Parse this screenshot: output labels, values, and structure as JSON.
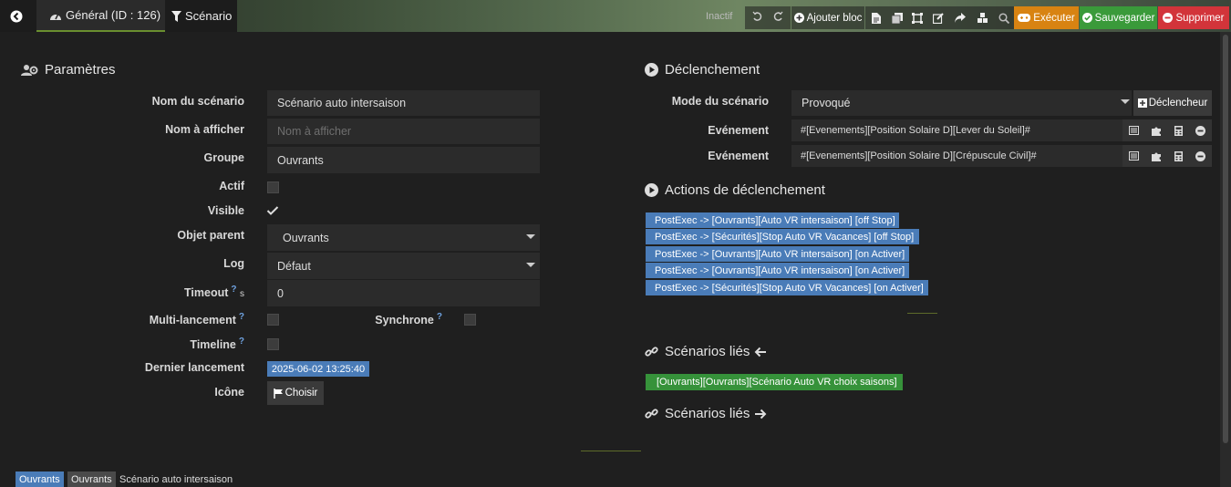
{
  "topbar": {
    "tab_general": "Général (ID : 126)",
    "tab_scenario": "Scénario",
    "status": "Inactif",
    "add_block": "Ajouter bloc",
    "execute": "Exécuter",
    "save": "Sauvegarder",
    "delete": "Supprimer",
    "colors": {
      "execute": "#d88312",
      "save": "#3a9a3a",
      "delete": "#d2343a"
    }
  },
  "params": {
    "title": "Paramètres",
    "name_label": "Nom du scénario",
    "name_value": "Scénario auto intersaison",
    "display_label": "Nom à afficher",
    "display_placeholder": "Nom à afficher",
    "group_label": "Groupe",
    "group_value": "Ouvrants",
    "active_label": "Actif",
    "active": false,
    "visible_label": "Visible",
    "visible": true,
    "parent_label": "Objet parent",
    "parent_value": "Ouvrants",
    "log_label": "Log",
    "log_value": "Défaut",
    "timeout_label": "Timeout",
    "timeout_unit": "s",
    "timeout_value": "0",
    "multi_label": "Multi-lancement",
    "multi": false,
    "sync_label": "Synchrone",
    "sync": false,
    "timeline_label": "Timeline",
    "timeline": false,
    "last_run_label": "Dernier lancement",
    "last_run_value": "2025-06-02 13:25:40",
    "icon_label": "Icône",
    "choose_button": "Choisir"
  },
  "trigger": {
    "title": "Déclenchement",
    "mode_label": "Mode du scénario",
    "mode_value": "Provoqué",
    "trigger_button": "Déclencheur",
    "events": [
      {
        "label": "Evénement",
        "value": "#[Evenements][Position Solaire D][Lever du Soleil]#"
      },
      {
        "label": "Evénement",
        "value": "#[Evenements][Position Solaire D][Crépuscule Civil]#"
      }
    ]
  },
  "actions": {
    "title": "Actions de déclenchement",
    "items": [
      "PostExec -> [Ouvrants][Auto VR intersaison] [off Stop]",
      "PostExec -> [Sécurités][Stop Auto VR Vacances] [off Stop]",
      "PostExec -> [Ouvrants][Auto VR intersaison] [on Activer]",
      "PostExec -> [Ouvrants][Auto VR intersaison] [on Activer]",
      "PostExec -> [Sécurités][Stop Auto VR Vacances] [on Activer]"
    ]
  },
  "linked_in": {
    "title": "Scénarios liés",
    "items": [
      "[Ouvrants][Ouvrants][Scénario Auto VR choix saisons]"
    ]
  },
  "linked_out": {
    "title": "Scénarios liés"
  },
  "breadcrumb": [
    "Ouvrants",
    "Ouvrants",
    "Scénario auto intersaison"
  ]
}
